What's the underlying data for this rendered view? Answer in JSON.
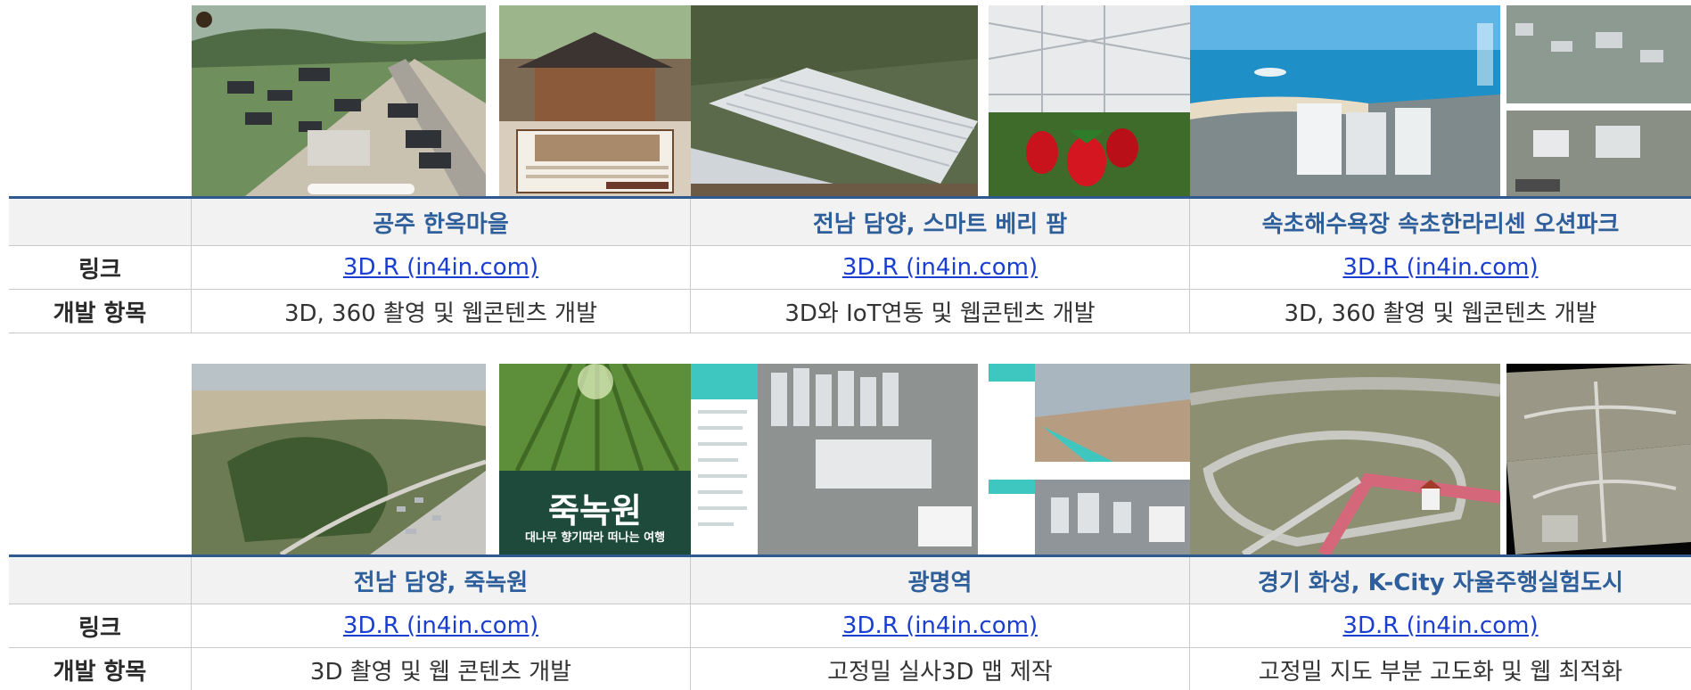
{
  "labels": {
    "link": "링크",
    "items": "개발 항목"
  },
  "block1": {
    "projects": [
      {
        "title": "공주 한옥마을",
        "link": "3D.R (in4in.com)",
        "items": "3D, 360 촬영 및 웹콘텐츠 개발"
      },
      {
        "title": "전남 담양, 스마트 베리 팜",
        "link": "3D.R (in4in.com)",
        "items": "3D와 IoT연동 및 웹콘텐츠 개발"
      },
      {
        "title": "속초해수욕장 속초한라리센 오션파크",
        "link": "3D.R (in4in.com)",
        "items": "3D, 360 촬영 및 웹콘텐츠 개발"
      }
    ]
  },
  "block2": {
    "projects": [
      {
        "title": "전남 담양, 죽녹원",
        "link": "3D.R (in4in.com)",
        "items": "3D 촬영 및 웹 콘텐츠 개발"
      },
      {
        "title": "광명역",
        "link": "3D.R (in4in.com)",
        "items": "고정밀 실사3D 맵 제작"
      },
      {
        "title": "경기 화성, K-City 자율주행실험도시",
        "link": "3D.R (in4in.com)",
        "items": "고정밀 지도 부분 고도화 및 웹 최적화"
      }
    ]
  },
  "images": {
    "juknokwon_title": "죽녹원",
    "juknokwon_subtitle": "대나무 향기따라 떠나는 여행"
  },
  "colors": {
    "header_border": "#2f5a8f",
    "title_text": "#2f5f9a",
    "link_text": "#1a3fd0",
    "label_bg": "#f2f2f2"
  }
}
